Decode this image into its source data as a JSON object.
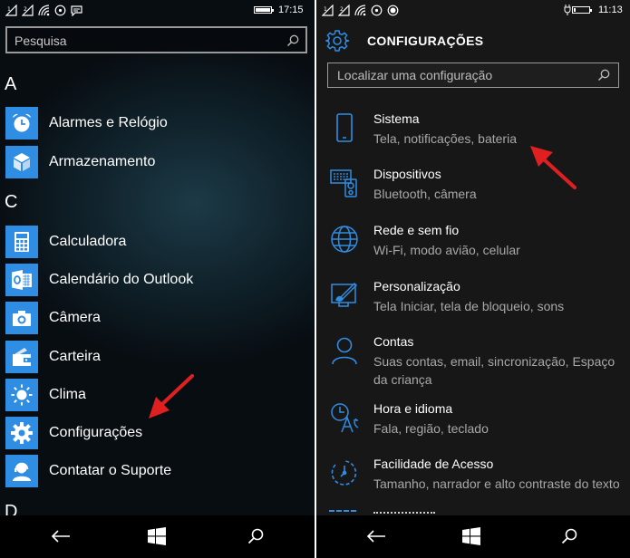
{
  "left_phone": {
    "status": {
      "time": "17:15",
      "battery_level": 0.9
    },
    "search": {
      "placeholder": "Pesquisa"
    },
    "sections": [
      {
        "letter": "A",
        "apps": [
          {
            "label": "Alarmes e Relógio",
            "icon": "alarm-clock-icon"
          },
          {
            "label": "Armazenamento",
            "icon": "storage-box-icon"
          }
        ]
      },
      {
        "letter": "C",
        "apps": [
          {
            "label": "Calculadora",
            "icon": "calculator-icon"
          },
          {
            "label": "Calendário do Outlook",
            "icon": "outlook-calendar-icon"
          },
          {
            "label": "Câmera",
            "icon": "camera-icon"
          },
          {
            "label": "Carteira",
            "icon": "wallet-icon"
          },
          {
            "label": "Clima",
            "icon": "sun-icon"
          },
          {
            "label": "Configurações",
            "icon": "gear-icon"
          },
          {
            "label": "Contatar o Suporte",
            "icon": "support-agent-icon"
          }
        ]
      },
      {
        "letter": "D"
      }
    ]
  },
  "right_phone": {
    "status": {
      "time": "11:13",
      "battery_level": 0.1
    },
    "header": {
      "title": "CONFIGURAÇÕES",
      "icon": "gear-icon"
    },
    "search": {
      "placeholder": "Localizar uma configuração"
    },
    "settings": [
      {
        "title": "Sistema",
        "subtitle": "Tela, notificações, bateria",
        "icon": "phone-icon"
      },
      {
        "title": "Dispositivos",
        "subtitle": "Bluetooth, câmera",
        "icon": "devices-icon"
      },
      {
        "title": "Rede e sem fio",
        "subtitle": "Wi-Fi, modo avião, celular",
        "icon": "globe-icon"
      },
      {
        "title": "Personalização",
        "subtitle": "Tela Iniciar, tela de bloqueio, sons",
        "icon": "paint-icon"
      },
      {
        "title": "Contas",
        "subtitle": "Suas contas, email, sincronização, Espaço da criança",
        "icon": "person-icon"
      },
      {
        "title": "Hora e idioma",
        "subtitle": "Fala, região, teclado",
        "icon": "time-language-icon"
      },
      {
        "title": "Facilidade de Acesso",
        "subtitle": "Tamanho, narrador e alto contraste do texto",
        "icon": "ease-of-access-icon"
      }
    ]
  },
  "navbar": {
    "buttons": [
      "back-icon",
      "windows-icon",
      "search-icon"
    ]
  },
  "colors": {
    "accent": "#2f8de3",
    "arrow": "#e02020",
    "settings_bg": "#171717",
    "nav_bg": "#000000"
  }
}
